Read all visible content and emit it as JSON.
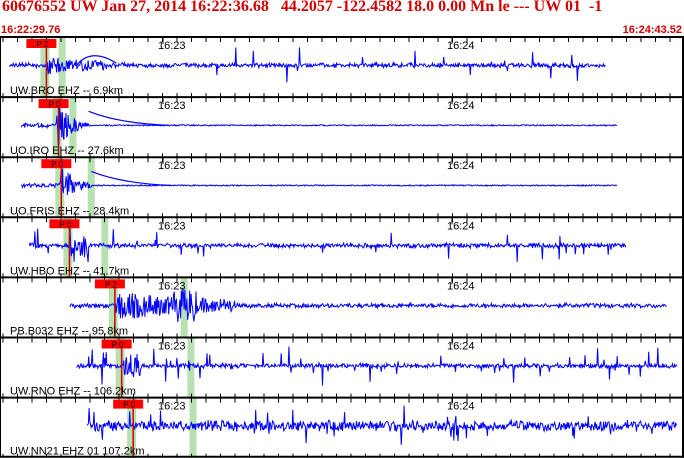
{
  "header": {
    "title": "60676552 UW Jan 27, 2014 16:22:36.68   44.2057 -122.4582 18.0 0.00 Mn le --- UW 01  -1",
    "start_time": "16:22:29.76",
    "end_time": "16:24:43.52"
  },
  "colors": {
    "trace": "#0000ff",
    "header_text": "#d40000",
    "pick_flag": "#ff0000",
    "pick_line": "#cc0000",
    "window_band": "#b8e0b0",
    "frame": "#000000"
  },
  "time_labels": [
    "16:23",
    "16:24"
  ],
  "panels": [
    {
      "station_label": "UW.BRO EHZ -- 6.9km",
      "pick_label": "P 2",
      "pick_time_frac": 0.064,
      "band_frac": 0.082,
      "trace_start_frac": 0.0,
      "trace_end_frac": 0.895,
      "style": "emergent-long"
    },
    {
      "station_label": "UO.IRO EHZ -- 27.6km",
      "pick_label": "P 0",
      "pick_time_frac": 0.082,
      "band_frac": 0.098,
      "trace_start_frac": 0.018,
      "trace_end_frac": 0.912,
      "style": "burst-decay"
    },
    {
      "station_label": "UO.FRIS EHZ -- 28.4km",
      "pick_label": "P 0",
      "pick_time_frac": 0.086,
      "band_frac": 0.125,
      "trace_start_frac": 0.018,
      "trace_end_frac": 0.912,
      "style": "burst-decay"
    },
    {
      "station_label": "UW.HBO EHZ -- 41.7km",
      "pick_label": "P 0",
      "pick_time_frac": 0.098,
      "band_frac": 0.145,
      "trace_start_frac": 0.03,
      "trace_end_frac": 0.925,
      "style": "spiky"
    },
    {
      "station_label": "PB.B032 EHZ -- 95.8km",
      "pick_label": "P 2",
      "pick_time_frac": 0.165,
      "band_frac": 0.262,
      "trace_start_frac": 0.09,
      "trace_end_frac": 0.985,
      "style": "emergent"
    },
    {
      "station_label": "UW.RNO EHZ -- 106.2km",
      "pick_label": "P 0",
      "pick_time_frac": 0.175,
      "band_frac": 0.272,
      "trace_start_frac": 0.1,
      "trace_end_frac": 1.0,
      "style": "spiky-dense"
    },
    {
      "station_label": "UW.NN21 EHZ 01 107.2km",
      "pick_label": "P 0",
      "pick_time_frac": 0.192,
      "band_frac": 0.275,
      "trace_start_frac": 0.115,
      "trace_end_frac": 1.0,
      "style": "noisy"
    }
  ]
}
